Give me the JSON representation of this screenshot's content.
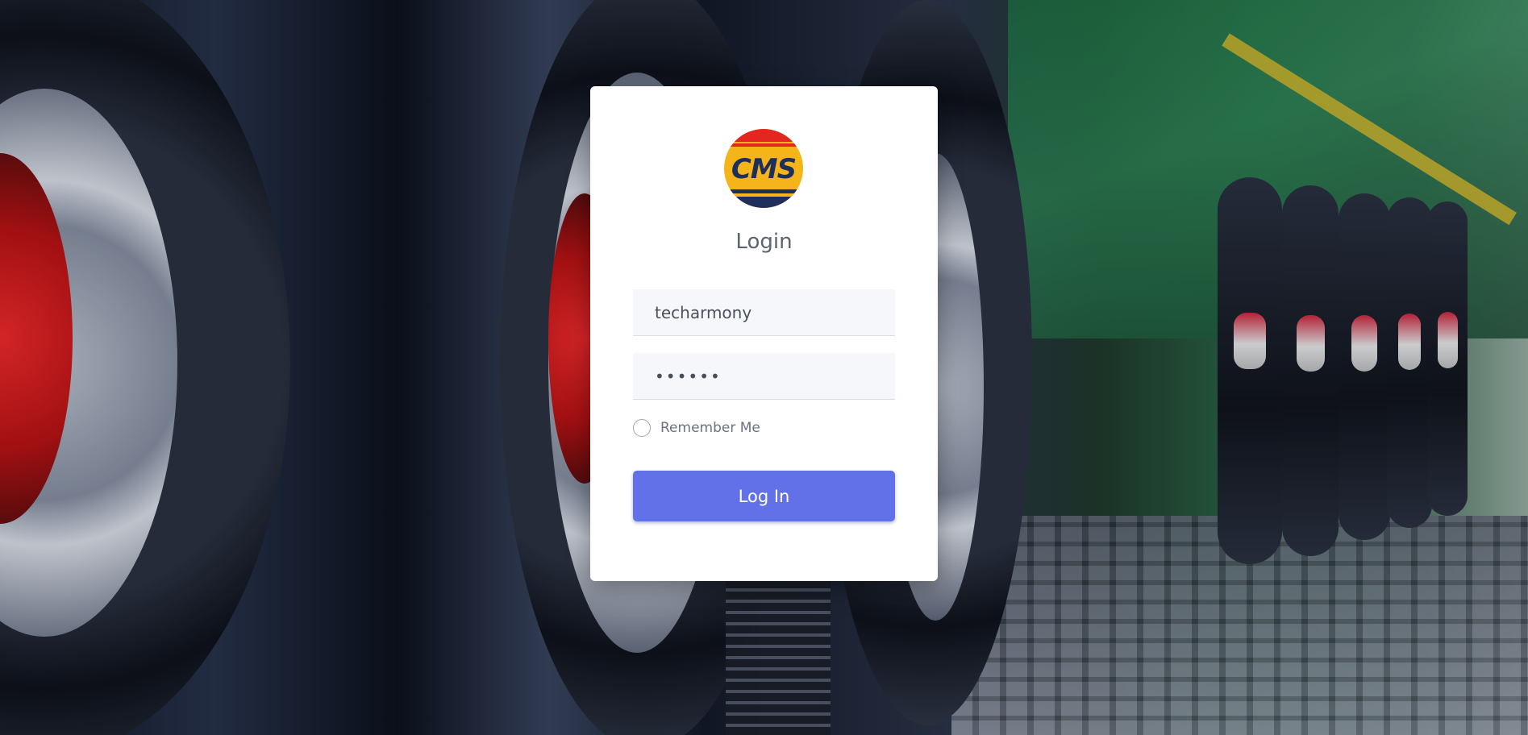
{
  "login": {
    "logo_text": "CMS",
    "title": "Login",
    "username_value": "techarmony",
    "password_value": "••••••",
    "remember_label": "Remember Me",
    "remember_checked": false,
    "submit_label": "Log In"
  },
  "colors": {
    "button": "#6371e8",
    "card": "#ffffff",
    "logo_yellow": "#f4b41a",
    "logo_red": "#e3261f",
    "logo_navy": "#1f2f5c"
  },
  "icons": {
    "logo": "cms-logo"
  }
}
